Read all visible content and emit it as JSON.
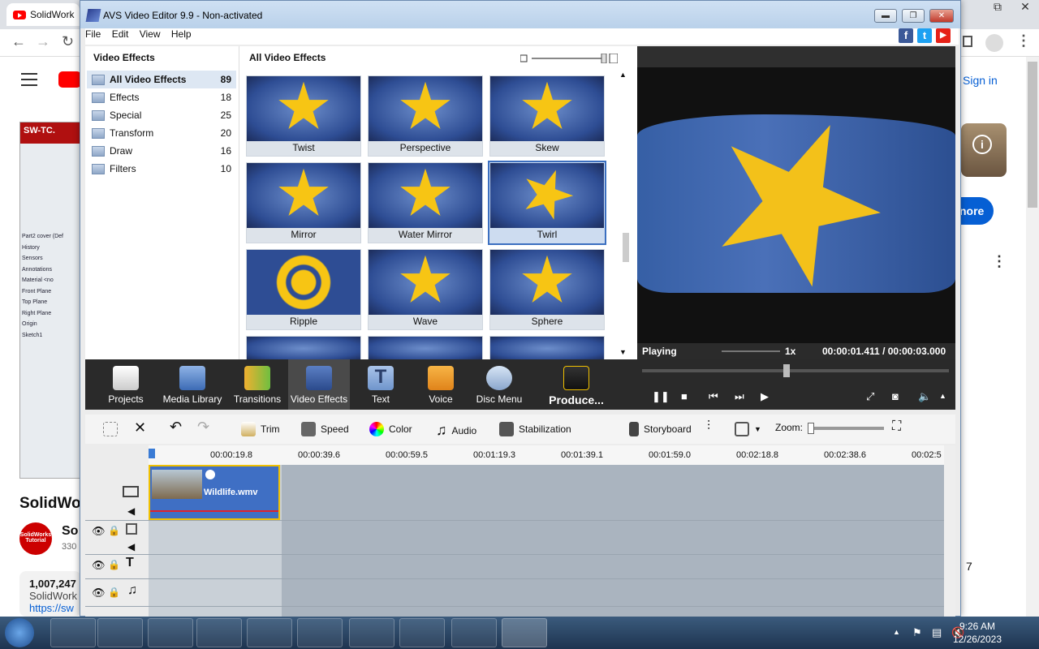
{
  "browser": {
    "tab_title": "SolidWork",
    "signin": "Sign in",
    "more_btn": "nore",
    "seven": "7",
    "left": {
      "sw_logo": "SW-TC.",
      "tree": [
        "Part2 cover (Def",
        "History",
        "Sensors",
        "Annotations",
        "Material <no",
        "Front Plane",
        "Top Plane",
        "Right Plane",
        "Origin",
        "Sketch1"
      ],
      "title": "SolidWo",
      "avatar": "SolidWorks Tutorial",
      "channel": "So",
      "subs": "330",
      "views": "1,007,247",
      "views2": "SolidWork",
      "link": "https://sw"
    }
  },
  "window": {
    "title": "AVS Video Editor 9.9 - Non-activated",
    "menu": [
      "File",
      "Edit",
      "View",
      "Help"
    ],
    "social": [
      "f",
      "t",
      "▶"
    ]
  },
  "categories": {
    "header": "Video Effects",
    "items": [
      {
        "label": "All Video Effects",
        "count": "89"
      },
      {
        "label": "Effects",
        "count": "18"
      },
      {
        "label": "Special",
        "count": "25"
      },
      {
        "label": "Transform",
        "count": "20"
      },
      {
        "label": "Draw",
        "count": "16"
      },
      {
        "label": "Filters",
        "count": "10"
      }
    ]
  },
  "grid": {
    "header": "All Video Effects",
    "effects": [
      "Twist",
      "Perspective",
      "Skew",
      "Mirror",
      "Water Mirror",
      "Twirl",
      "Ripple",
      "Wave",
      "Sphere"
    ],
    "selected": "Twirl"
  },
  "player": {
    "status": "Playing",
    "speed": "1x",
    "time": "00:00:01.411 / 00:00:03.000"
  },
  "tools": [
    "Projects",
    "Media Library",
    "Transitions",
    "Video Effects",
    "Text",
    "Voice",
    "Disc Menu",
    "Produce..."
  ],
  "edit": {
    "trim": "Trim",
    "speed": "Speed",
    "color": "Color",
    "audio": "Audio",
    "stabilization": "Stabilization",
    "storyboard": "Storyboard",
    "zoom": "Zoom:"
  },
  "ruler": [
    "00:00:19.8",
    "00:00:39.6",
    "00:00:59.5",
    "00:01:19.3",
    "00:01:39.1",
    "00:01:59.0",
    "00:02:18.8",
    "00:02:38.6",
    "00:02:5"
  ],
  "clip": {
    "name": "Wildlife.wmv"
  },
  "clock": {
    "time": "9:26 AM",
    "date": "12/26/2023"
  }
}
